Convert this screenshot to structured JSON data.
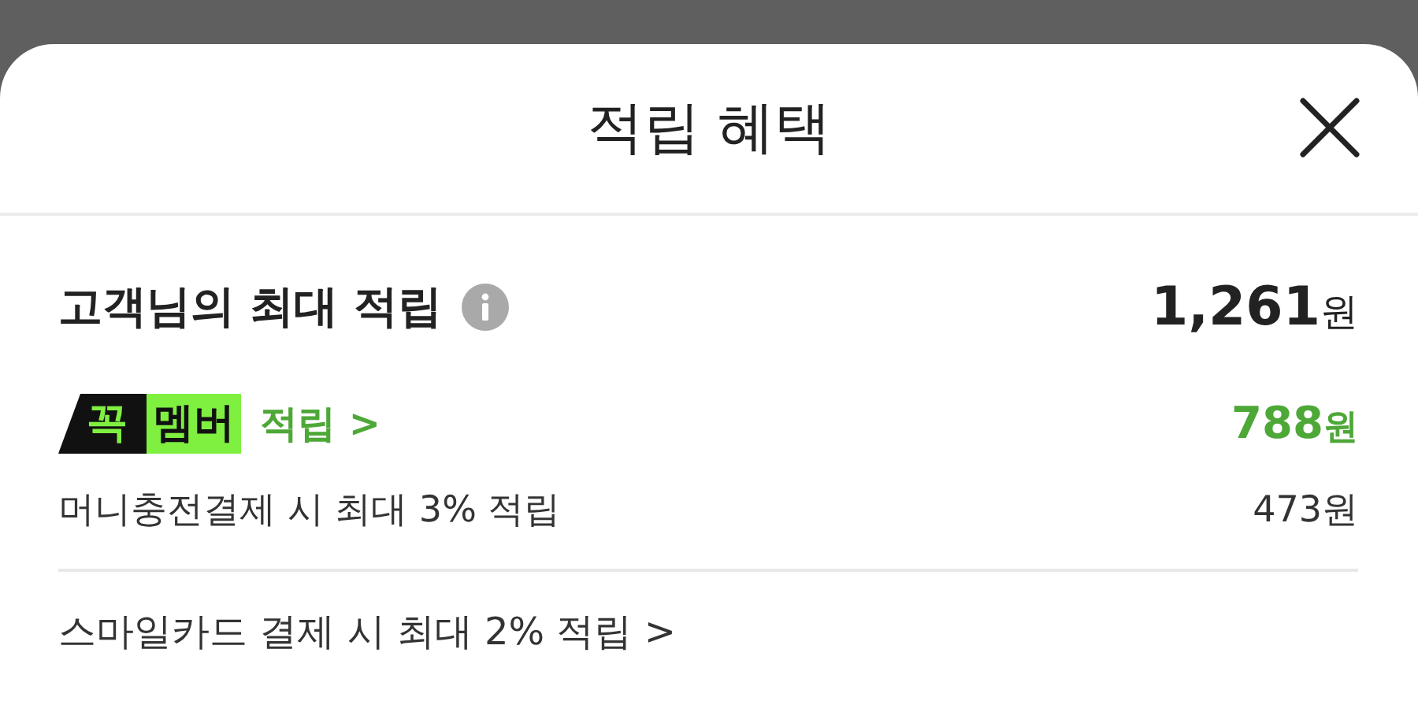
{
  "sheet": {
    "title": "적립 혜택"
  },
  "summary": {
    "label": "고객님의 최대 적립",
    "amount": "**1,261**원"
  },
  "membership": {
    "badge_mark": "꼭",
    "badge_label": "멤버",
    "link": "적립 >",
    "amount": "**788**원"
  },
  "rows": [
    {
      "kind": "detail",
      "text": "머니충전결제 시 최대 3% 적립",
      "amount": "473원"
    },
    {
      "kind": "link",
      "text": "스마일카드 결제 시 최대 2% 적립 >"
    }
  ]
}
